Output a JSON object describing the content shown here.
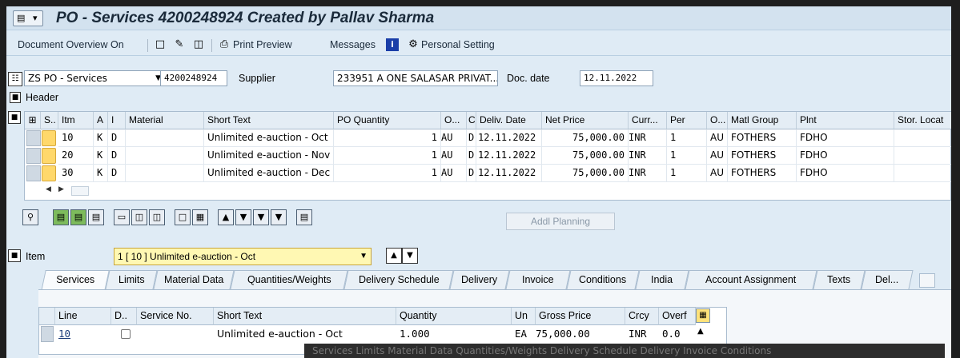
{
  "window": {
    "title": "PO - Services 4200248924 Created by Pallav Sharma"
  },
  "toolbar": {
    "document_overview": "Document Overview On",
    "print_preview": "Print Preview",
    "messages": "Messages",
    "personal_setting": "Personal Setting"
  },
  "header": {
    "po_type": "ZS PO - Services",
    "po_number": "4200248924",
    "supplier_label": "Supplier",
    "supplier_value": "233951 A ONE SALASAR PRIVAT...",
    "doc_date_label": "Doc. date",
    "doc_date_value": "12.11.2022",
    "header_label": "Header"
  },
  "items_grid": {
    "columns": [
      "S..",
      "Itm",
      "A",
      "I",
      "Material",
      "Short Text",
      "PO Quantity",
      "O...",
      "C",
      "Deliv. Date",
      "Net Price",
      "Curr...",
      "Per",
      "O...",
      "Matl Group",
      "Plnt",
      "Stor. Locat"
    ],
    "rows": [
      {
        "itm": "10",
        "a": "K",
        "i": "D",
        "material": "",
        "short_text": "Unlimited e-auction - Oct",
        "qty": "1",
        "uom": "AU",
        "c": "D",
        "deliv_date": "12.11.2022",
        "net_price": "75,000.00",
        "curr": "INR",
        "per": "1",
        "o": "AU",
        "matl_group": "FOTHERS",
        "plnt": "FDHO",
        "stor": ""
      },
      {
        "itm": "20",
        "a": "K",
        "i": "D",
        "material": "",
        "short_text": "Unlimited e-auction - Nov",
        "qty": "1",
        "uom": "AU",
        "c": "D",
        "deliv_date": "12.11.2022",
        "net_price": "75,000.00",
        "curr": "INR",
        "per": "1",
        "o": "AU",
        "matl_group": "FOTHERS",
        "plnt": "FDHO",
        "stor": ""
      },
      {
        "itm": "30",
        "a": "K",
        "i": "D",
        "material": "",
        "short_text": "Unlimited e-auction - Dec",
        "qty": "1",
        "uom": "AU",
        "c": "D",
        "deliv_date": "12.11.2022",
        "net_price": "75,000.00",
        "curr": "INR",
        "per": "1",
        "o": "AU",
        "matl_group": "FOTHERS",
        "plnt": "FDHO",
        "stor": ""
      }
    ]
  },
  "addl_planning": "Addl Planning",
  "item_section": {
    "label": "Item",
    "selected": "1 [ 10 ] Unlimited e-auction - Oct"
  },
  "tabs": [
    "Services",
    "Limits",
    "Material Data",
    "Quantities/Weights",
    "Delivery Schedule",
    "Delivery",
    "Invoice",
    "Conditions",
    "India",
    "Account Assignment",
    "Texts",
    "Del..."
  ],
  "services": {
    "columns": [
      "Line",
      "D..",
      "Service No.",
      "Short Text",
      "Quantity",
      "Un",
      "Gross Price",
      "Crcy",
      "Overf"
    ],
    "row": {
      "line": "10",
      "service_no": "",
      "short_text": "Unlimited e-auction - Oct",
      "quantity": "1.000",
      "un": "EA",
      "gross_price": "75,000.00",
      "crcy": "INR",
      "overf": "0.0"
    }
  },
  "ghost_tabs": "Services     Limits     Material Data     Quantities/Weights     Delivery Schedule     Delivery     Invoice     Conditions"
}
